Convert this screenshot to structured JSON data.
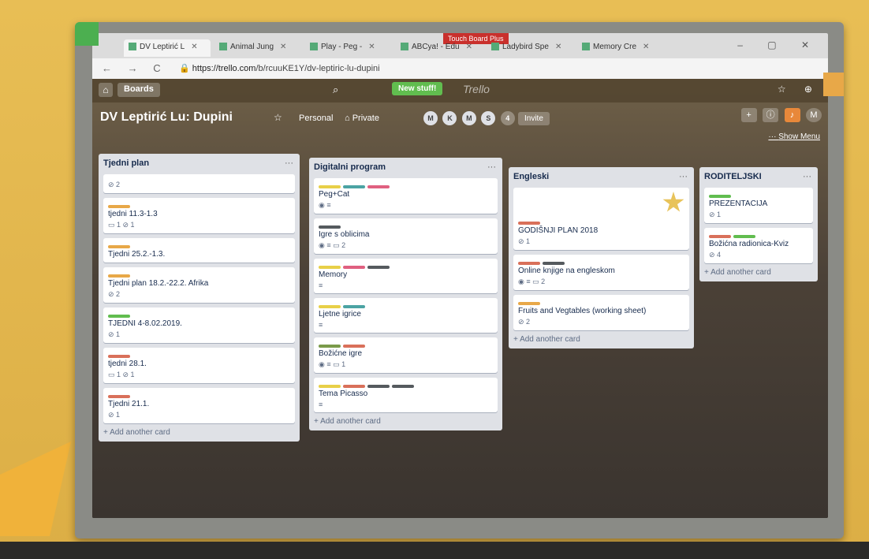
{
  "browser": {
    "touchboard": "Touch Board Plus",
    "tabs": [
      {
        "label": "DV Leptirić L",
        "active": true
      },
      {
        "label": "Animal Jung"
      },
      {
        "label": "Play - Peg -"
      },
      {
        "label": "ABCya! - Edu"
      },
      {
        "label": "Ladybird Spe"
      },
      {
        "label": "Memory Cre"
      }
    ],
    "url_host": "https://trello.com",
    "url_path": "/b/rcuuKE1Y/dv-leptiric-lu-dupini"
  },
  "header": {
    "boards_label": "Boards",
    "new_stuff": "New stuff!",
    "logo": "Trello"
  },
  "board": {
    "title": "DV Leptirić Lu: Dupini",
    "personal": "Personal",
    "privacy": "Private",
    "members": [
      "M",
      "K",
      "M",
      "S"
    ],
    "member_count": "4",
    "invite": "Invite",
    "show_menu": "Show Menu",
    "avatar": "M"
  },
  "lists": [
    {
      "title": "Tjedni plan",
      "cards": [
        {
          "title": "",
          "labels": [],
          "badges": "⊘ 2"
        },
        {
          "title": "tjedni 11.3-1.3",
          "labels": [
            "#e8a848"
          ],
          "badges": "▭ 1   ⊘ 1"
        },
        {
          "title": "Tjedni 25.2.-1.3.",
          "labels": [
            "#e8a848"
          ],
          "badges": ""
        },
        {
          "title": "Tjedni plan 18.2.-22.2. Afrika",
          "labels": [
            "#e8a848"
          ],
          "badges": "⊘ 2"
        },
        {
          "title": "TJEDNI 4-8.02.2019.",
          "labels": [
            "#61bd4f"
          ],
          "badges": "⊘ 1"
        },
        {
          "title": "tjedni 28.1.",
          "labels": [
            "#d9705a"
          ],
          "badges": "▭ 1   ⊘ 1"
        },
        {
          "title": "Tjedni 21.1.",
          "labels": [
            "#d9705a"
          ],
          "badges": "⊘ 1"
        }
      ],
      "add": "+ Add another card"
    },
    {
      "title": "Digitalni program",
      "cards": [
        {
          "title": "Peg+Cat",
          "labels": [
            "#e8d048",
            "#4ba3a3",
            "#e06080"
          ],
          "badges": "◉  ≡"
        },
        {
          "title": "Igre s oblicima",
          "labels": [
            "#555a5e"
          ],
          "badges": "◉  ≡  ▭ 2"
        },
        {
          "title": "Memory",
          "labels": [
            "#e8d048",
            "#e06080",
            "#555a5e"
          ],
          "badges": "≡"
        },
        {
          "title": "Ljetne igrice",
          "labels": [
            "#e8d048",
            "#4ba3a3"
          ],
          "badges": "≡"
        },
        {
          "title": "Božićne igre",
          "labels": [
            "#7a9a4a",
            "#d9705a"
          ],
          "badges": "◉  ≡  ▭ 1"
        },
        {
          "title": "Tema Picasso",
          "labels": [
            "#e8d048",
            "#d9705a",
            "#555a5e",
            "#555a5e"
          ],
          "badges": "≡"
        }
      ],
      "add": "+ Add another card"
    },
    {
      "title": "Engleski",
      "cards": [
        {
          "title": "GODIŠNJI PLAN 2018",
          "labels": [
            "#d9705a"
          ],
          "badges": "⊘ 1",
          "star": true
        },
        {
          "title": "Online knjige na engleskom",
          "labels": [
            "#d9705a",
            "#555a5e"
          ],
          "badges": "◉  ≡  ▭ 2"
        },
        {
          "title": "Fruits and Vegtables (working sheet)",
          "labels": [
            "#e8a848"
          ],
          "badges": "⊘ 2"
        }
      ],
      "add": "+ Add another card"
    },
    {
      "title": "RODITELJSKI",
      "cards": [
        {
          "title": "PREZENTACIJA",
          "labels": [
            "#61bd4f"
          ],
          "badges": "⊘ 1"
        },
        {
          "title": "Božićna radionica-Kviz",
          "labels": [
            "#d9705a",
            "#61bd4f"
          ],
          "badges": "⊘ 4"
        }
      ],
      "add": "+ Add another card"
    }
  ]
}
